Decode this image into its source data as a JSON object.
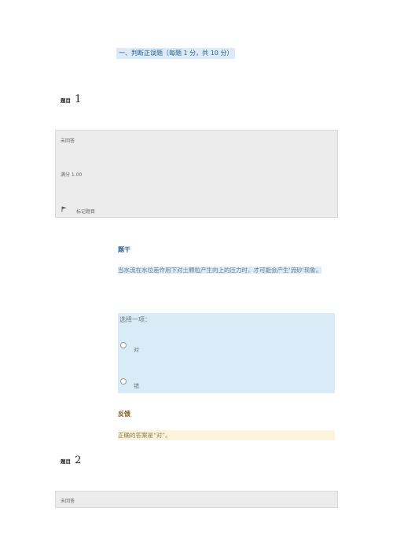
{
  "section": {
    "heading": "一、判断正误题（每题 1 分，共 10 分）"
  },
  "questions": [
    {
      "label": "题目",
      "number": "1",
      "status": "未回答",
      "score": "满分 1.00",
      "flag_label": "标记题目",
      "content_heading": "题干",
      "stem": "当水流在水位差作用下对土颗粒产生向上的压力时，才可能会产生'流砂'现象。",
      "prompt": "选择一项：",
      "options": [
        "对",
        "错"
      ],
      "feedback_heading": "反馈",
      "feedback": "正确的答案是“对”。"
    },
    {
      "label": "题目",
      "number": "2",
      "status": "未回答"
    }
  ],
  "colors": {
    "heading_bg": "#dbeaf6",
    "info_bg": "#ececec",
    "answer_bg": "#d9ebf7",
    "feedback_bg": "#fcf3dc",
    "content_heading": "#2a5f93",
    "feedback_heading": "#8a5a1e"
  },
  "icons": {
    "flag": "flag-icon"
  }
}
